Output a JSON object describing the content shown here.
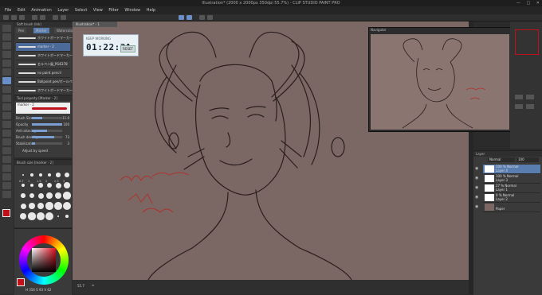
{
  "window": {
    "title": "Illustration* (2000 x 2000px 350dpi 55.7%)  - CLIP STUDIO PAINT PRO",
    "controls": [
      "—",
      "□",
      "✕"
    ]
  },
  "menu": [
    "File",
    "Edit",
    "Animation",
    "Layer",
    "Select",
    "View",
    "Filter",
    "Window",
    "Help"
  ],
  "subtool": {
    "tab_title": "Soft brush (Ink)",
    "tabs": [
      "Pen",
      "Marker",
      "Watercolor"
    ],
    "brushes": [
      "ホワイトボードマーカー",
      "marker - 2",
      "ホワイトボードマーカー 2",
      "セルペン風_PG6378",
      "no paint pencil",
      "Ballpoint pen/ボールペン",
      "ホワイトボードマーカー"
    ]
  },
  "tool_property": {
    "title": "Tool property [Marker - 2]",
    "header": "marker - 2",
    "props": [
      {
        "label": "Brush Size",
        "value": "11.0"
      },
      {
        "label": "Opacity",
        "value": "100"
      },
      {
        "label": "Anti-aliasing",
        "value": ""
      },
      {
        "label": "Brush density",
        "value": "73"
      },
      {
        "label": "Stabilization",
        "value": "3"
      }
    ],
    "fills": [
      0.35,
      1.0,
      0.5,
      0.73,
      0.1
    ],
    "checkbox": "Adjust by speed"
  },
  "brush_size_panel": {
    "title": "Brush size [marker - 2]",
    "sizes": [
      "0.7",
      "1",
      "1.5",
      "2",
      "2.5",
      "3",
      "4",
      "5",
      "6",
      "7",
      "8",
      "10"
    ]
  },
  "color": {
    "main": "#c0101a",
    "wheel_square": "#7a0a14"
  },
  "document": {
    "tab": "Illustration* - 1"
  },
  "timer": {
    "label": "KEEP WORKING",
    "time": "01:22:31",
    "button": "RESET"
  },
  "status": {
    "zoom": "55.7",
    "hint": "≡"
  },
  "navigator": {
    "title": "Navigator"
  },
  "layers": {
    "title": "Layer",
    "blend_mode": "Normal",
    "opacity": "100",
    "items": [
      {
        "mode": "100 % Normal",
        "name": "Layer 4"
      },
      {
        "mode": "100 % Normal",
        "name": "Layer 3"
      },
      {
        "mode": "27 % Normal",
        "name": "Layer 1"
      },
      {
        "mode": "0 % Normal",
        "name": "Layer 2"
      },
      {
        "mode": "",
        "name": "Paper"
      }
    ]
  },
  "canvas_bg": "#7b6763"
}
